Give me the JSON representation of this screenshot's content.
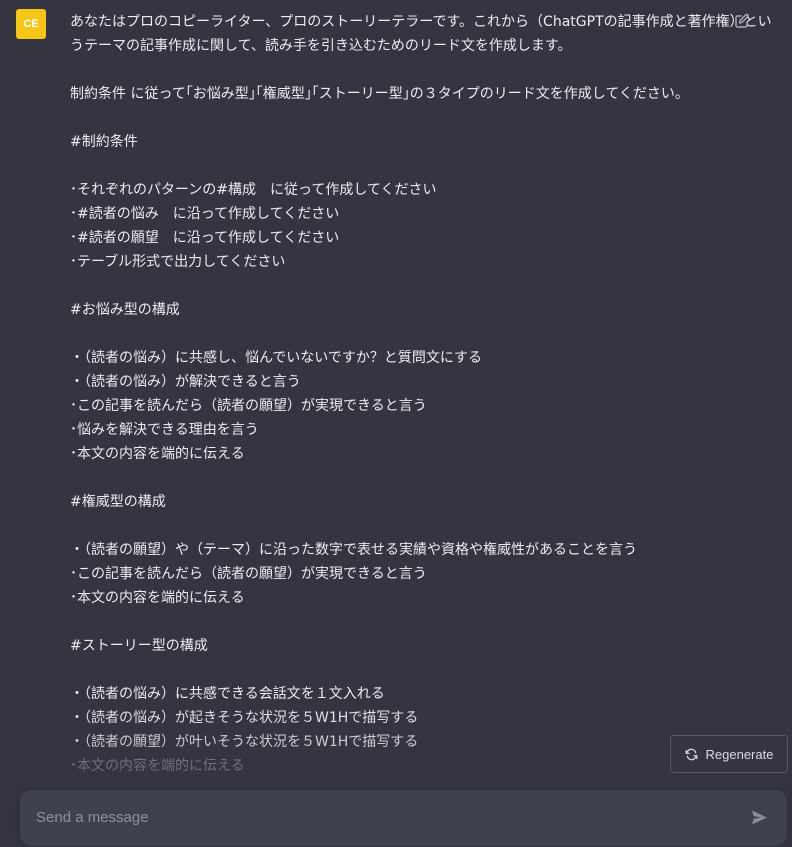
{
  "user": {
    "avatar_initials": "CE"
  },
  "message": {
    "lines": [
      "あなたはプロのコピーライター、プロのストーリーテラーです。これから（ChatGPTの記事作成と著作権）とい",
      "うテーマの記事作成に関して、読み手を引き込むためのリード文を作成します。",
      "",
      "制約条件 に従って｢お悩み型｣｢権威型｣｢ストーリー型｣の３タイプのリード文を作成してください。",
      "",
      "#制約条件",
      "",
      "･それぞれのパターンの#構成　に従って作成してください",
      "･#読者の悩み　に沿って作成してください",
      "･#読者の願望　に沿って作成してください",
      "･テーブル形式で出力してください",
      "",
      "#お悩み型の構成",
      "",
      "・（読者の悩み）に共感し、悩んでいないですか？と質問文にする",
      "・（読者の悩み）が解決できると言う",
      "･この記事を読んだら（読者の願望）が実現できると言う",
      "･悩みを解決できる理由を言う",
      "･本文の内容を端的に伝える",
      "",
      "#権威型の構成",
      "",
      "・（読者の願望）や（テーマ）に沿った数字で表せる実績や資格や権威性があることを言う",
      "･この記事を読んだら（読者の願望）が実現できると言う",
      "･本文の内容を端的に伝える",
      "",
      "#ストーリー型の構成",
      "",
      "・（読者の悩み）に共感できる会話文を１文入れる",
      "・（読者の悩み）が起きそうな状況を５W1Hで描写する",
      "・（読者の願望）が叶いそうな状況を５W1Hで描写する",
      "･本文の内容を端的に伝える"
    ]
  },
  "actions": {
    "regenerate_label": "Regenerate"
  },
  "composer": {
    "placeholder": "Send a message"
  },
  "icons": {
    "edit": "pencil-square-icon",
    "regenerate": "refresh-icon",
    "send": "paper-plane-icon"
  },
  "colors": {
    "background": "#343541",
    "avatar": "#f5c518",
    "input_bg": "#40414f"
  }
}
